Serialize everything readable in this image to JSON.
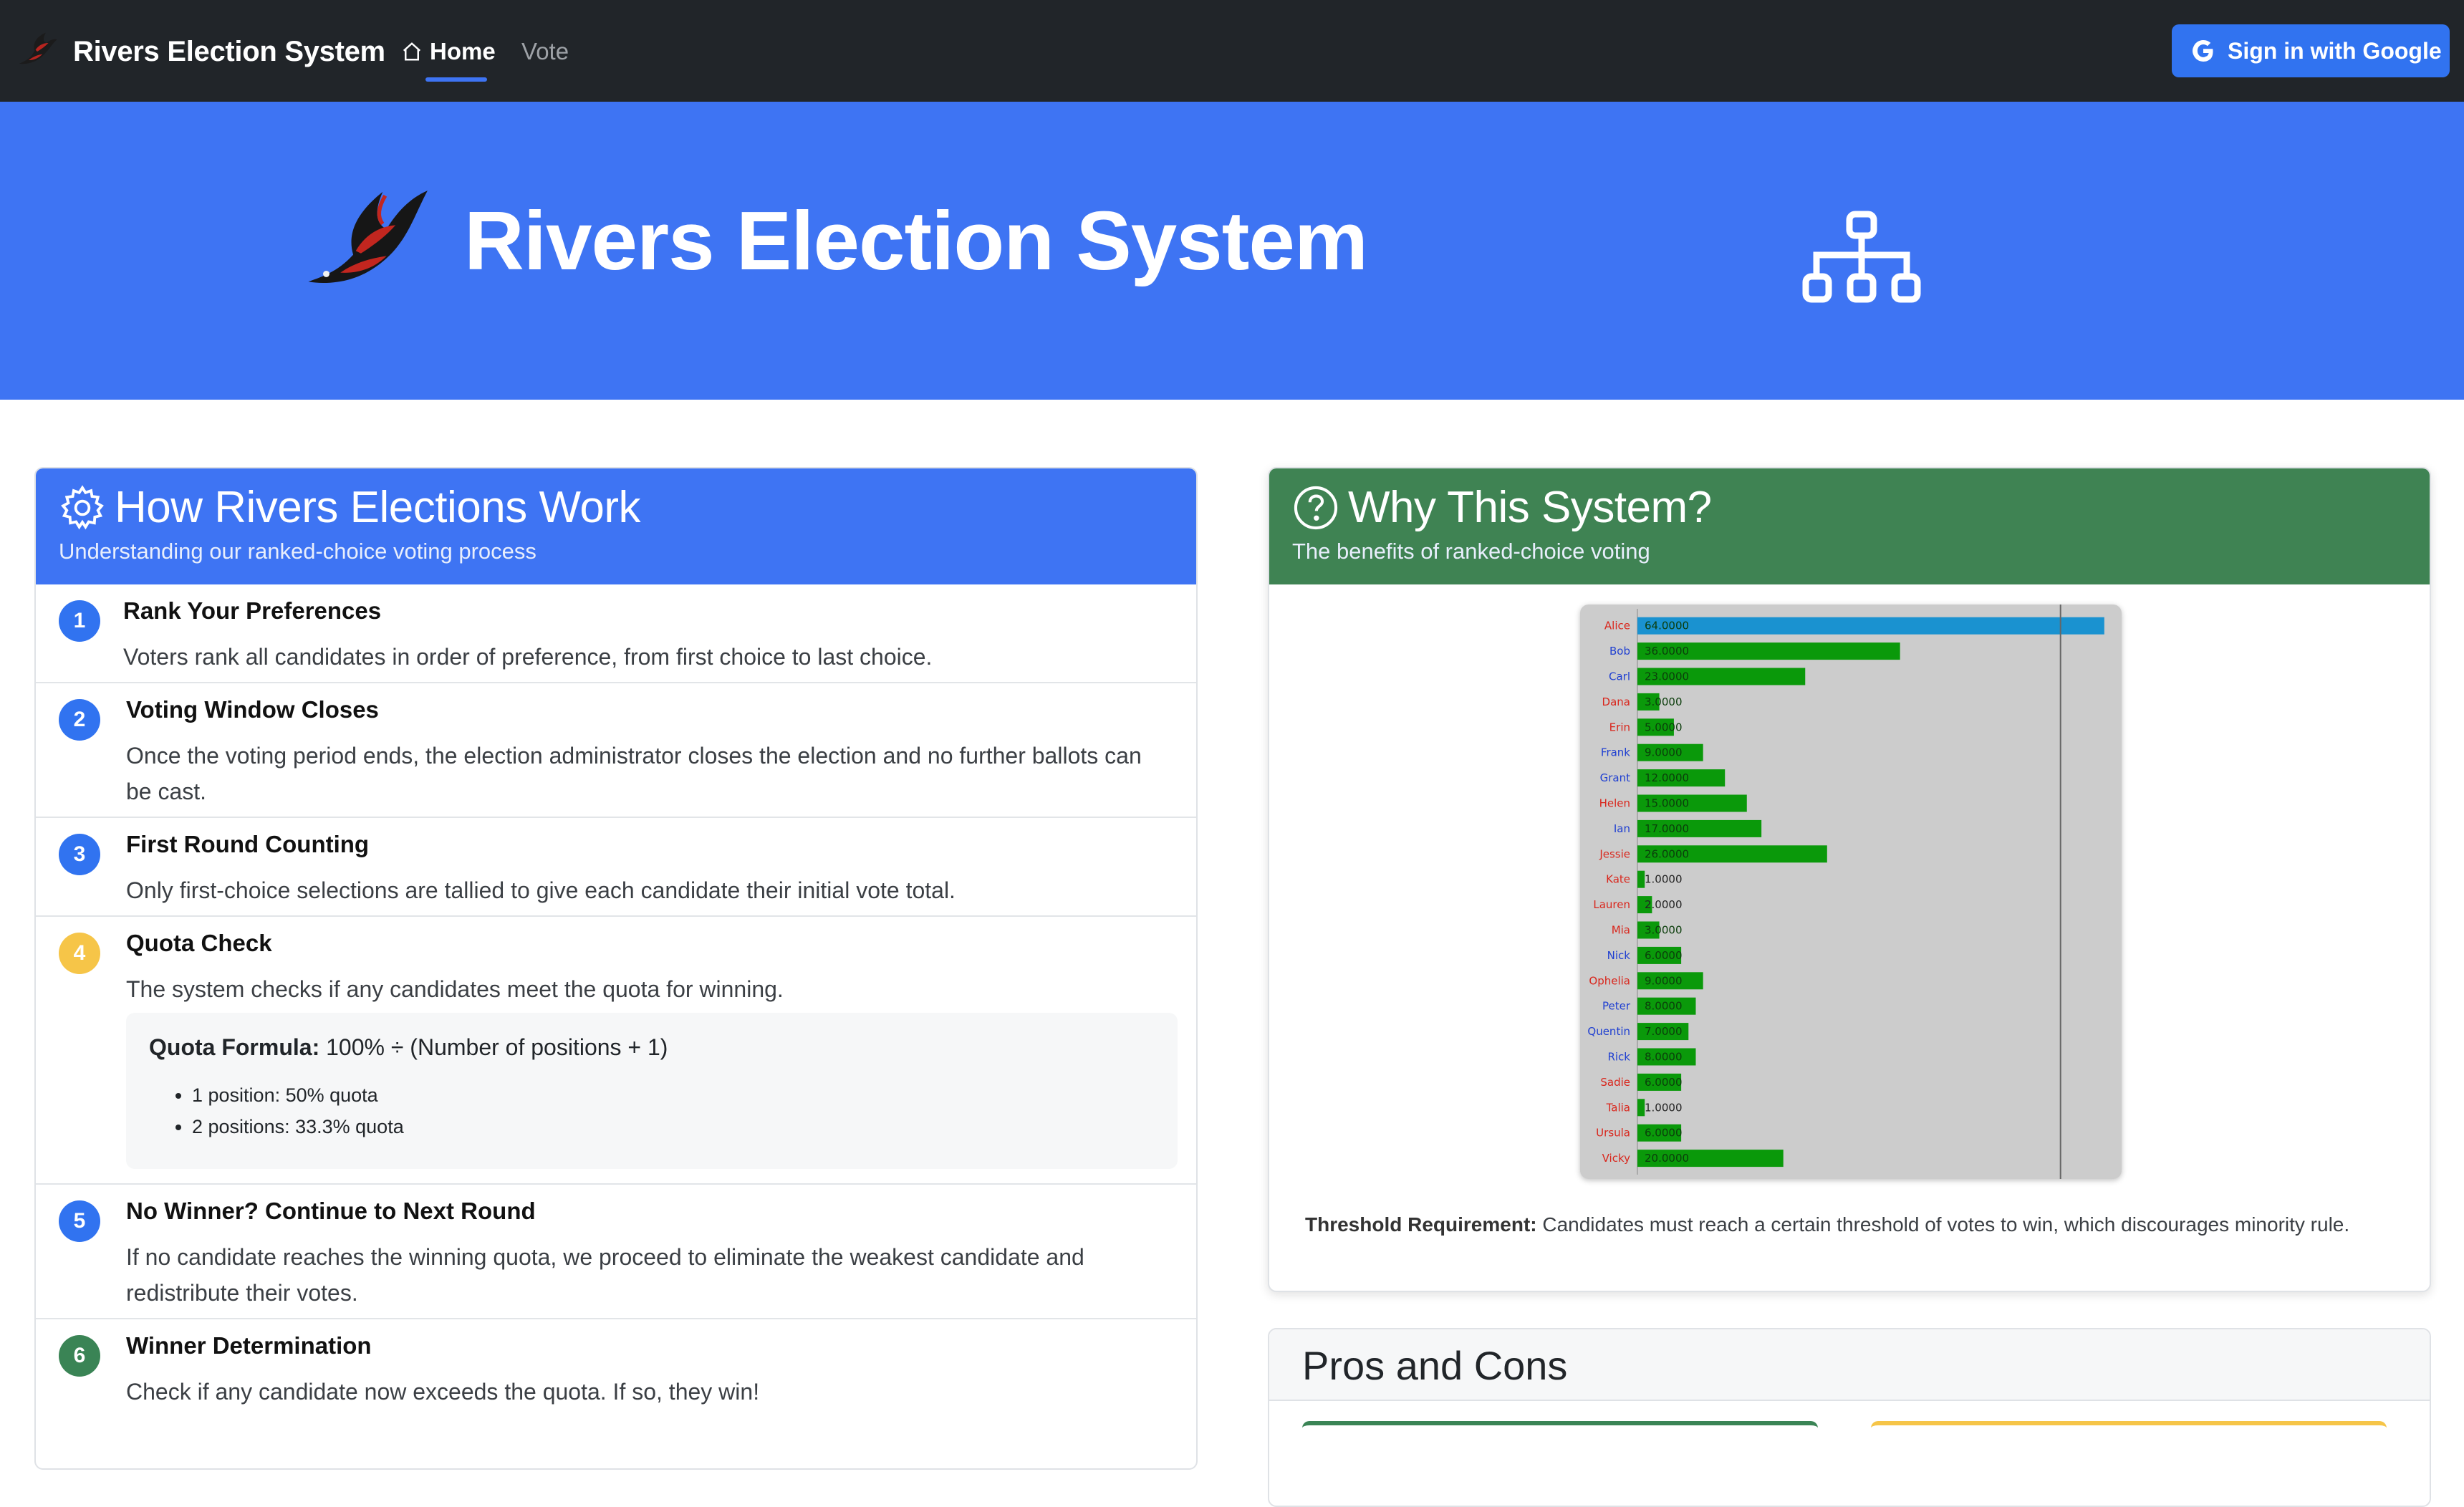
{
  "navbar": {
    "brand": "Rivers Election System",
    "links": [
      {
        "label": "Home",
        "active": true
      },
      {
        "label": "Vote",
        "active": false
      }
    ],
    "signin_label": "Sign in with Google"
  },
  "hero": {
    "title": "Rivers Election System",
    "icon": "network-diagram-icon"
  },
  "how_card": {
    "title": "How Rivers Elections Work",
    "subtitle": "Understanding our ranked-choice voting process",
    "icon": "gear-icon",
    "steps": [
      {
        "num": "1",
        "title": "Rank Your Preferences",
        "desc": "Voters rank all candidates in order of preference, from first choice to last choice."
      },
      {
        "num": "2",
        "title": "Voting Window Closes",
        "desc": "Once the voting period ends, the election administrator closes the election and no further ballots can be cast."
      },
      {
        "num": "3",
        "title": "First Round Counting",
        "desc": "Only first-choice selections are tallied to give each candidate their initial vote total."
      },
      {
        "num": "4",
        "title": "Quota Check",
        "desc": "The system checks if any candidates meet the quota for winning."
      },
      {
        "num": "5",
        "title": "No Winner? Continue to Next Round",
        "desc": "If no candidate reaches the winning quota, we proceed to eliminate the weakest candidate and redistribute their votes."
      },
      {
        "num": "6",
        "title": "Winner Determination",
        "desc": "Check if any candidate now exceeds the quota. If so, they win!"
      }
    ],
    "quota": {
      "label": "Quota Formula:",
      "formula": "100% ÷ (Number of positions + 1)",
      "items": [
        "1 position: 50% quota",
        "2 positions: 33.3% quota"
      ]
    }
  },
  "why_card": {
    "title": "Why This System?",
    "subtitle": "The benefits of ranked-choice voting",
    "icon": "question-circle-icon",
    "threshold_label": "Threshold Requirement:",
    "threshold_text": " Candidates must reach a certain threshold of votes to win, which discourages minority rule."
  },
  "pros_cons": {
    "title": "Pros and Cons"
  },
  "colors": {
    "navbar": "#212529",
    "primary": "#3e74f3",
    "success": "#3f8353",
    "warning": "#f6c548",
    "bar_green": "#0a990a",
    "bar_leader": "#1a92d0",
    "name_red": "#d9261c",
    "name_blue": "#1f3fd1"
  },
  "chart_data": {
    "type": "bar",
    "orientation": "horizontal",
    "categories": [
      "Alice",
      "Bob",
      "Carl",
      "Dana",
      "Erin",
      "Frank",
      "Grant",
      "Helen",
      "Ian",
      "Jessie",
      "Kate",
      "Lauren",
      "Mia",
      "Nick",
      "Ophelia",
      "Peter",
      "Quentin",
      "Rick",
      "Sadie",
      "Talia",
      "Ursula",
      "Vicky"
    ],
    "values": [
      64,
      36,
      23,
      3,
      5,
      9,
      12,
      15,
      17,
      26,
      1,
      2,
      3,
      6,
      9,
      8,
      7,
      8,
      6,
      1,
      6,
      20
    ],
    "value_labels": [
      "64.0000",
      "36.0000",
      "23.0000",
      "3.0000",
      "5.0000",
      "9.0000",
      "12.0000",
      "15.0000",
      "17.0000",
      "26.0000",
      "1.0000",
      "2.0000",
      "3.0000",
      "6.0000",
      "9.0000",
      "8.0000",
      "7.0000",
      "8.0000",
      "6.0000",
      "1.0000",
      "6.0000",
      "20.0000"
    ],
    "name_colors": [
      "red",
      "blue",
      "blue",
      "red",
      "red",
      "blue",
      "blue",
      "red",
      "blue",
      "red",
      "red",
      "red",
      "red",
      "blue",
      "red",
      "blue",
      "blue",
      "blue",
      "red",
      "red",
      "red",
      "red"
    ],
    "threshold": 58,
    "xlim": [
      0,
      65
    ],
    "grid": false
  }
}
